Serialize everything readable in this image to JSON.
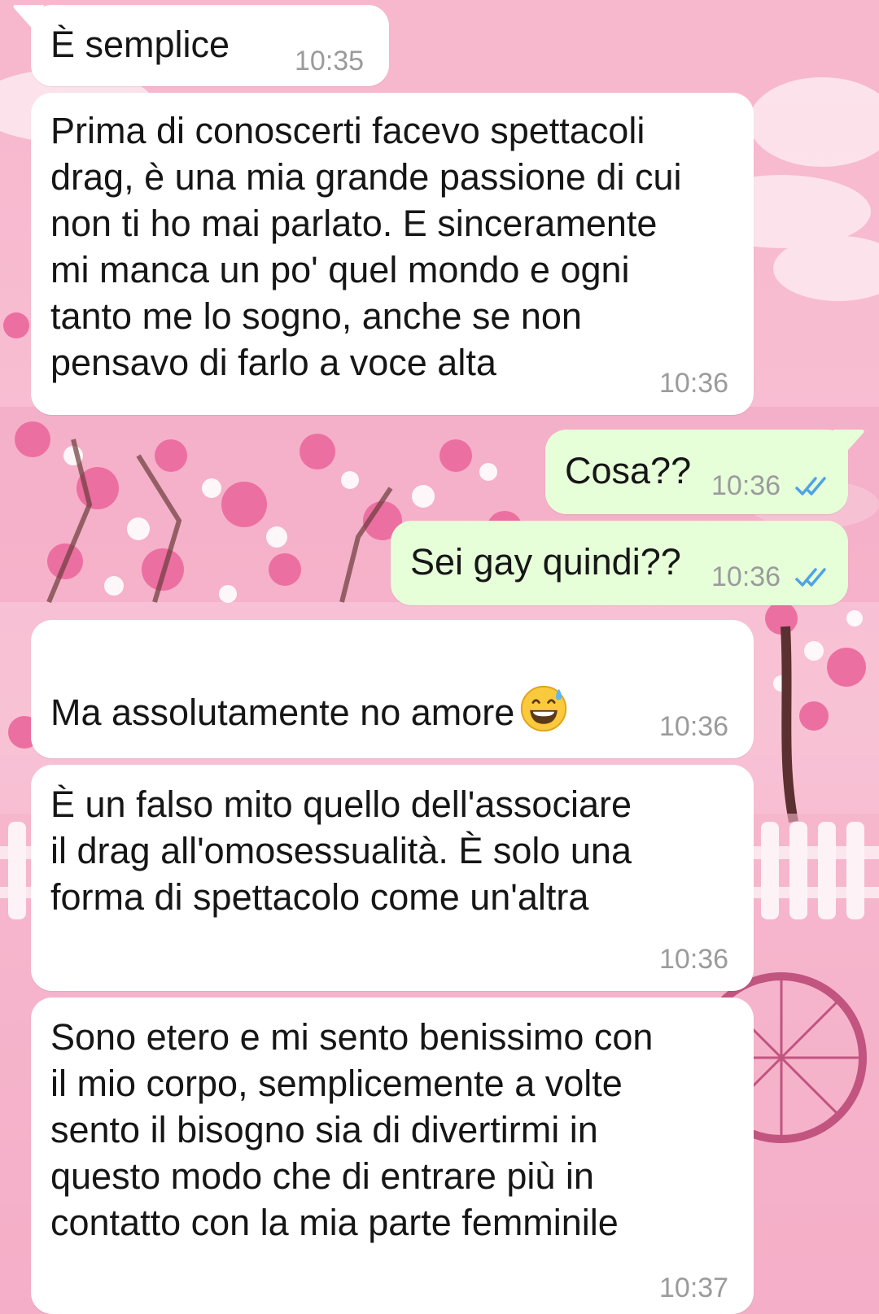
{
  "conversation": {
    "messages": [
      {
        "direction": "in",
        "text": "È semplice",
        "time": "10:35"
      },
      {
        "direction": "in",
        "text": "Prima di conoscerti facevo spettacoli\ndrag, è una mia grande passione di cui\nnon ti ho mai parlato. E sinceramente\nmi manca un po' quel mondo e ogni\ntanto me lo sogno, anche se non\npensavo di farlo a voce alta",
        "time": "10:36"
      },
      {
        "direction": "out",
        "text": "Cosa??",
        "time": "10:36",
        "status": "read"
      },
      {
        "direction": "out",
        "text": "Sei gay quindi??",
        "time": "10:36",
        "status": "read"
      },
      {
        "direction": "in",
        "text": "Ma assolutamente no amore",
        "emoji": "grinning-face-with-sweat",
        "time": "10:36"
      },
      {
        "direction": "in",
        "text": "È un falso mito quello dell'associare\nil drag all'omosessualità. È solo una\nforma di spettacolo come un'altra",
        "time": "10:36"
      },
      {
        "direction": "in",
        "text": "Sono etero e mi sento benissimo con\nil mio corpo, semplicemente a volte\nsento il bisogno sia di divertirmi in\nquesto modo che di entrare più in\ncontatto con la mia parte femminile",
        "time": "10:37"
      }
    ]
  },
  "colors": {
    "incoming_bubble": "#ffffff",
    "outgoing_bubble": "#e6ffd9",
    "timestamp": "#9b9b9b",
    "read_ticks": "#4fa3e6",
    "wallpaper_sky": "#f6b9cf"
  },
  "icons": {
    "read_receipt": "double-check-icon",
    "wallpaper": "cherry-blossom-wallpaper"
  }
}
